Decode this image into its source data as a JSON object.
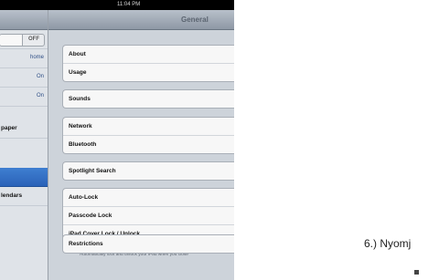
{
  "status_bar": {
    "time": "11:04 PM"
  },
  "detail": {
    "title": "General"
  },
  "master": {
    "toggle": "OFF",
    "rows": [
      {
        "value": "home"
      },
      {
        "value": "On"
      },
      {
        "value": "On"
      },
      {
        "label": "paper"
      },
      {
        "label": ""
      },
      {
        "label": "lendars"
      }
    ]
  },
  "groups": [
    [
      "About",
      "Usage"
    ],
    [
      "Sounds"
    ],
    [
      "Network",
      "Bluetooth"
    ],
    [
      "Spotlight Search"
    ],
    [
      "Auto-Lock",
      "Passcode Lock",
      "iPad Cover Lock / Unlock"
    ],
    [
      "Restrictions"
    ]
  ],
  "footer_note": "Automatically lock and unlock your iPad when you close",
  "caption": "6.) Nyomj"
}
